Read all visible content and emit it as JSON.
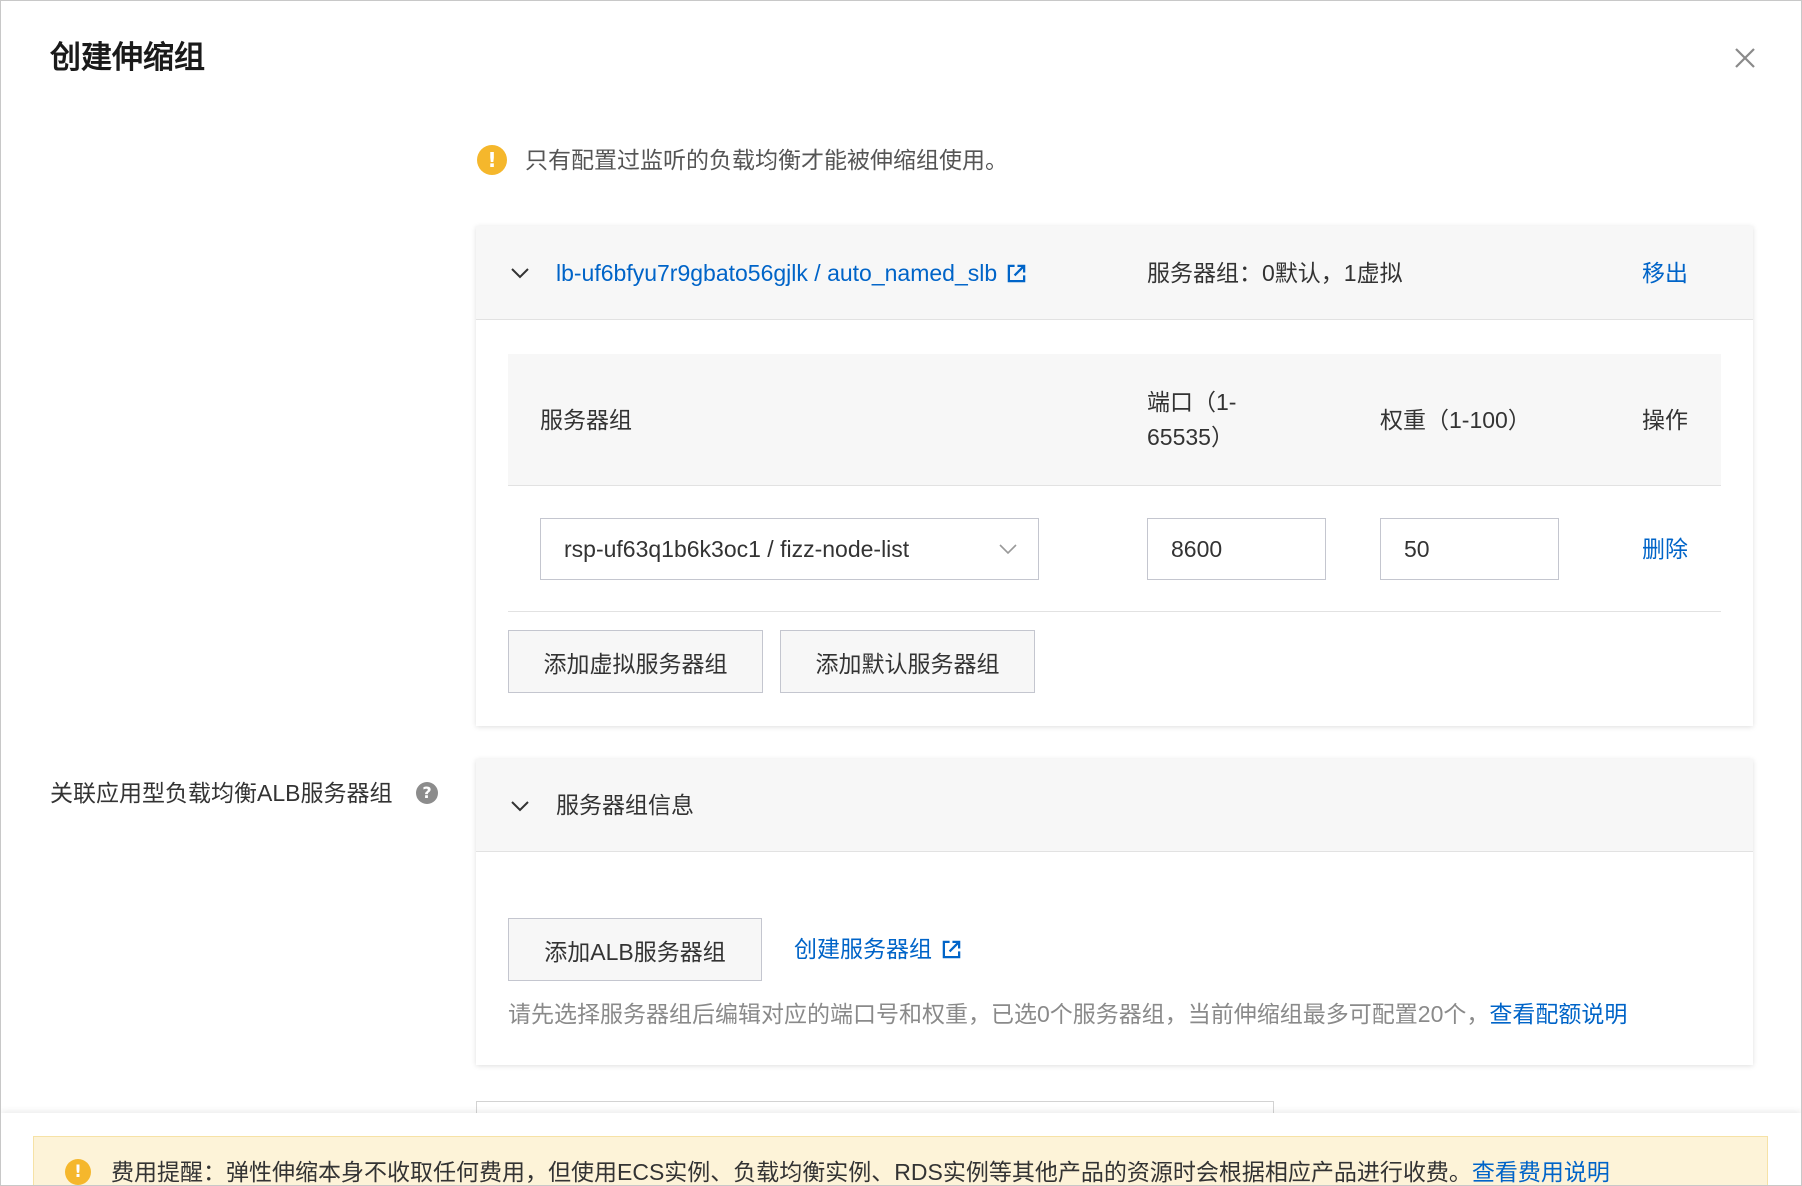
{
  "dialog": {
    "title": "创建伸缩组",
    "close_icon": "close-icon"
  },
  "notice": {
    "icon": "warning-icon",
    "icon_color": "#f5b72c",
    "text": "只有配置过监听的负载均衡才能被伸缩组使用。"
  },
  "slb_card": {
    "expand_icon": "chevron-down-icon",
    "lb_link": "lb-uf6bfyu7r9gbato56gjlk / auto_named_slb",
    "lb_link_icon": "external-link-icon",
    "server_groups_summary": "服务器组：0默认，1虚拟",
    "remove_label": "移出",
    "table": {
      "headers": [
        "服务器组",
        "端口（1-65535）",
        "权重（1-100）",
        "操作"
      ],
      "rows": [
        {
          "server_group": "rsp-uf63q1b6k3oc1 / fizz-node-list",
          "port": "8600",
          "weight": "50",
          "action": "删除"
        }
      ]
    },
    "add_virtual_label": "添加虚拟服务器组",
    "add_default_label": "添加默认服务器组"
  },
  "alb_section": {
    "label": "关联应用型负载均衡ALB服务器组",
    "help_icon": "help-icon",
    "card_title": "服务器组信息",
    "add_button": "添加ALB服务器组",
    "create_link": "创建服务器组",
    "hint": "请先选择服务器组后编辑对应的端口号和权重，已选0个服务器组，当前伸缩组最多可配置20个，",
    "quota_link": "查看配额说明"
  },
  "footer": {
    "icon": "warning-icon",
    "text": "费用提醒：弹性伸缩本身不收取任何费用，但使用ECS实例、负载均衡实例、RDS实例等其他产品的资源时会根据相应产品进行收费。",
    "link": "查看费用说明"
  },
  "colors": {
    "link": "#0064c8",
    "panel_bg": "#f7f7f7",
    "fee_bg": "#fdf3d8"
  }
}
